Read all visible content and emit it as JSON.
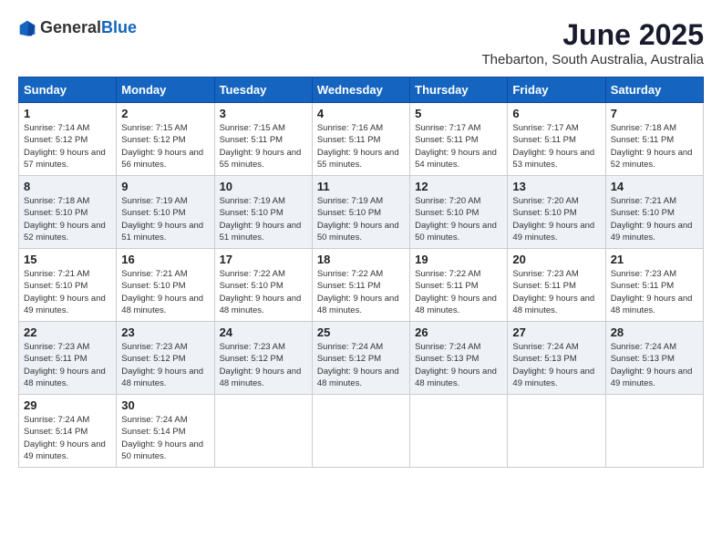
{
  "header": {
    "logo_general": "General",
    "logo_blue": "Blue",
    "month_year": "June 2025",
    "location": "Thebarton, South Australia, Australia"
  },
  "weekdays": [
    "Sunday",
    "Monday",
    "Tuesday",
    "Wednesday",
    "Thursday",
    "Friday",
    "Saturday"
  ],
  "weeks": [
    [
      {
        "day": "1",
        "sunrise": "7:14 AM",
        "sunset": "5:12 PM",
        "daylight": "9 hours and 57 minutes."
      },
      {
        "day": "2",
        "sunrise": "7:15 AM",
        "sunset": "5:12 PM",
        "daylight": "9 hours and 56 minutes."
      },
      {
        "day": "3",
        "sunrise": "7:15 AM",
        "sunset": "5:11 PM",
        "daylight": "9 hours and 55 minutes."
      },
      {
        "day": "4",
        "sunrise": "7:16 AM",
        "sunset": "5:11 PM",
        "daylight": "9 hours and 55 minutes."
      },
      {
        "day": "5",
        "sunrise": "7:17 AM",
        "sunset": "5:11 PM",
        "daylight": "9 hours and 54 minutes."
      },
      {
        "day": "6",
        "sunrise": "7:17 AM",
        "sunset": "5:11 PM",
        "daylight": "9 hours and 53 minutes."
      },
      {
        "day": "7",
        "sunrise": "7:18 AM",
        "sunset": "5:11 PM",
        "daylight": "9 hours and 52 minutes."
      }
    ],
    [
      {
        "day": "8",
        "sunrise": "7:18 AM",
        "sunset": "5:10 PM",
        "daylight": "9 hours and 52 minutes."
      },
      {
        "day": "9",
        "sunrise": "7:19 AM",
        "sunset": "5:10 PM",
        "daylight": "9 hours and 51 minutes."
      },
      {
        "day": "10",
        "sunrise": "7:19 AM",
        "sunset": "5:10 PM",
        "daylight": "9 hours and 51 minutes."
      },
      {
        "day": "11",
        "sunrise": "7:19 AM",
        "sunset": "5:10 PM",
        "daylight": "9 hours and 50 minutes."
      },
      {
        "day": "12",
        "sunrise": "7:20 AM",
        "sunset": "5:10 PM",
        "daylight": "9 hours and 50 minutes."
      },
      {
        "day": "13",
        "sunrise": "7:20 AM",
        "sunset": "5:10 PM",
        "daylight": "9 hours and 49 minutes."
      },
      {
        "day": "14",
        "sunrise": "7:21 AM",
        "sunset": "5:10 PM",
        "daylight": "9 hours and 49 minutes."
      }
    ],
    [
      {
        "day": "15",
        "sunrise": "7:21 AM",
        "sunset": "5:10 PM",
        "daylight": "9 hours and 49 minutes."
      },
      {
        "day": "16",
        "sunrise": "7:21 AM",
        "sunset": "5:10 PM",
        "daylight": "9 hours and 48 minutes."
      },
      {
        "day": "17",
        "sunrise": "7:22 AM",
        "sunset": "5:10 PM",
        "daylight": "9 hours and 48 minutes."
      },
      {
        "day": "18",
        "sunrise": "7:22 AM",
        "sunset": "5:11 PM",
        "daylight": "9 hours and 48 minutes."
      },
      {
        "day": "19",
        "sunrise": "7:22 AM",
        "sunset": "5:11 PM",
        "daylight": "9 hours and 48 minutes."
      },
      {
        "day": "20",
        "sunrise": "7:23 AM",
        "sunset": "5:11 PM",
        "daylight": "9 hours and 48 minutes."
      },
      {
        "day": "21",
        "sunrise": "7:23 AM",
        "sunset": "5:11 PM",
        "daylight": "9 hours and 48 minutes."
      }
    ],
    [
      {
        "day": "22",
        "sunrise": "7:23 AM",
        "sunset": "5:11 PM",
        "daylight": "9 hours and 48 minutes."
      },
      {
        "day": "23",
        "sunrise": "7:23 AM",
        "sunset": "5:12 PM",
        "daylight": "9 hours and 48 minutes."
      },
      {
        "day": "24",
        "sunrise": "7:23 AM",
        "sunset": "5:12 PM",
        "daylight": "9 hours and 48 minutes."
      },
      {
        "day": "25",
        "sunrise": "7:24 AM",
        "sunset": "5:12 PM",
        "daylight": "9 hours and 48 minutes."
      },
      {
        "day": "26",
        "sunrise": "7:24 AM",
        "sunset": "5:13 PM",
        "daylight": "9 hours and 48 minutes."
      },
      {
        "day": "27",
        "sunrise": "7:24 AM",
        "sunset": "5:13 PM",
        "daylight": "9 hours and 49 minutes."
      },
      {
        "day": "28",
        "sunrise": "7:24 AM",
        "sunset": "5:13 PM",
        "daylight": "9 hours and 49 minutes."
      }
    ],
    [
      {
        "day": "29",
        "sunrise": "7:24 AM",
        "sunset": "5:14 PM",
        "daylight": "9 hours and 49 minutes."
      },
      {
        "day": "30",
        "sunrise": "7:24 AM",
        "sunset": "5:14 PM",
        "daylight": "9 hours and 50 minutes."
      },
      null,
      null,
      null,
      null,
      null
    ]
  ]
}
